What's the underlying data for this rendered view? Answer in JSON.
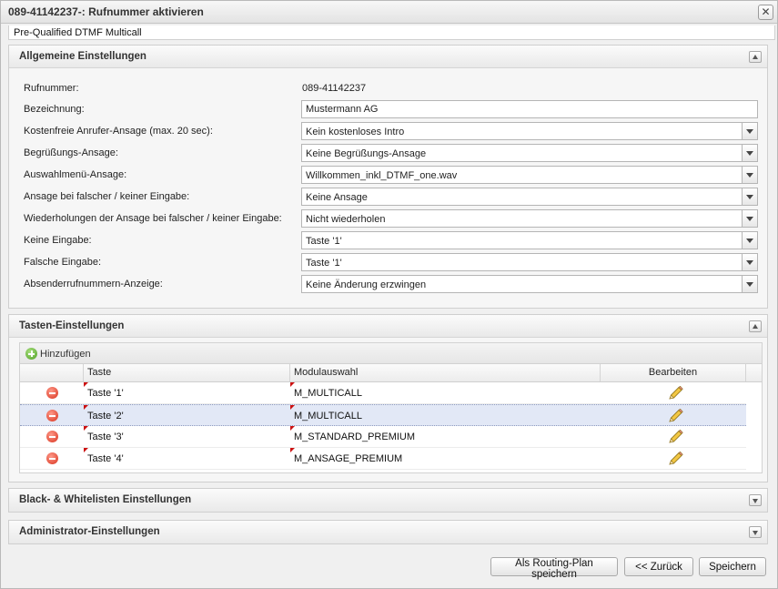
{
  "window": {
    "title": "089-41142237-: Rufnummer aktivieren",
    "type_label": "Pre-Qualified DTMF Multicall",
    "close_glyph": "✕"
  },
  "general": {
    "title": "Allgemeine Einstellungen",
    "fields": {
      "rufnummer": {
        "label": "Rufnummer:",
        "value": "089-41142237"
      },
      "bezeichnung": {
        "label": "Bezeichnung:",
        "value": "Mustermann AG"
      },
      "kostenfrei": {
        "label": "Kostenfreie Anrufer-Ansage (max. 20 sec):",
        "value": "Kein kostenloses Intro"
      },
      "begruessung": {
        "label": "Begrüßungs-Ansage:",
        "value": "Keine Begrüßungs-Ansage"
      },
      "auswahlmenue": {
        "label": "Auswahlmenü-Ansage:",
        "value": "Willkommen_inkl_DTMF_one.wav"
      },
      "falsche_ansage": {
        "label": "Ansage bei falscher / keiner Eingabe:",
        "value": "Keine Ansage"
      },
      "wiederholungen": {
        "label": "Wiederholungen der Ansage bei falscher / keiner Eingabe:",
        "value": "Nicht wiederholen"
      },
      "keine_eingabe": {
        "label": "Keine Eingabe:",
        "value": "Taste '1'"
      },
      "falsche_eingabe": {
        "label": "Falsche Eingabe:",
        "value": "Taste '1'"
      },
      "absender": {
        "label": "Absenderrufnummern-Anzeige:",
        "value": "Keine Änderung erzwingen"
      }
    }
  },
  "keys": {
    "title": "Tasten-Einstellungen",
    "add_label": "Hinzufügen",
    "columns": {
      "taste": "Taste",
      "modul": "Modulauswahl",
      "edit": "Bearbeiten"
    },
    "rows": [
      {
        "taste": "Taste '1'",
        "modul": "M_MULTICALL"
      },
      {
        "taste": "Taste '2'",
        "modul": "M_MULTICALL"
      },
      {
        "taste": "Taste '3'",
        "modul": "M_STANDARD_PREMIUM"
      },
      {
        "taste": "Taste '4'",
        "modul": "M_ANSAGE_PREMIUM"
      }
    ]
  },
  "blackwhite": {
    "title": "Black- & Whitelisten Einstellungen"
  },
  "admin": {
    "title": "Administrator-Einstellungen"
  },
  "footer": {
    "routing_label": "Als Routing-Plan speichern",
    "back_label": "<< Zurück",
    "save_label": "Speichern"
  }
}
